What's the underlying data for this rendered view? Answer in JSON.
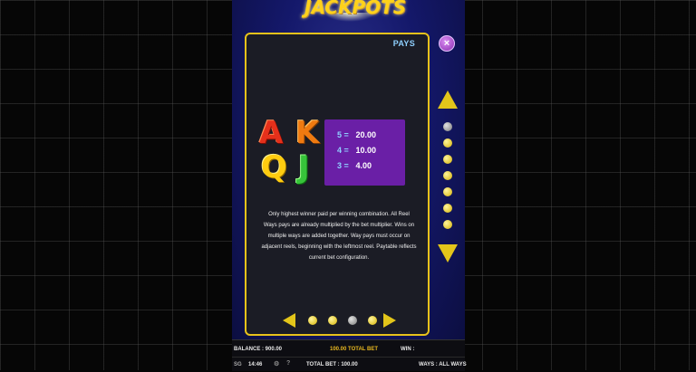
{
  "game": {
    "logo_text": "JACKPOTS",
    "page_title": "PAYS",
    "close_symbol": "×"
  },
  "paytable": {
    "symbols": [
      "A",
      "K",
      "Q",
      "J"
    ],
    "payouts": [
      {
        "count": "5 =",
        "value": "20.00"
      },
      {
        "count": "4 =",
        "value": "10.00"
      },
      {
        "count": "3 =",
        "value": "4.00"
      }
    ],
    "rules_text": "Only highest winner paid per winning combination. All Reel Ways pays are already multiplied by the bet multiplier. Wins on multiple ways are added together. Way pays must occur on adjacent reels, beginning with the leftmost reel. Paytable reflects current bet configuration."
  },
  "pagination": {
    "total_pages": 4,
    "current_page": 3
  },
  "side_scroll": {
    "total_steps": 8,
    "current_step": 1
  },
  "status_bar": {
    "balance": "BALANCE : 900.00",
    "total_bet_top": "100.00 TOTAL BET",
    "win": "WIN :",
    "logo": "SG",
    "clock": "14:46",
    "total_bet": "TOTAL BET : 100.00",
    "ways": "WAYS : ALL WAYS"
  },
  "colors": {
    "frame_gold": "#e8c21a",
    "payout_purple": "#6a1fa6",
    "panel_blue": "#14186a"
  },
  "icons": {
    "close": "close-icon",
    "prev": "arrow-left-icon",
    "next": "arrow-right-icon",
    "up": "arrow-up-icon",
    "down": "arrow-down-icon",
    "settings": "gear-icon",
    "help": "help-icon"
  }
}
